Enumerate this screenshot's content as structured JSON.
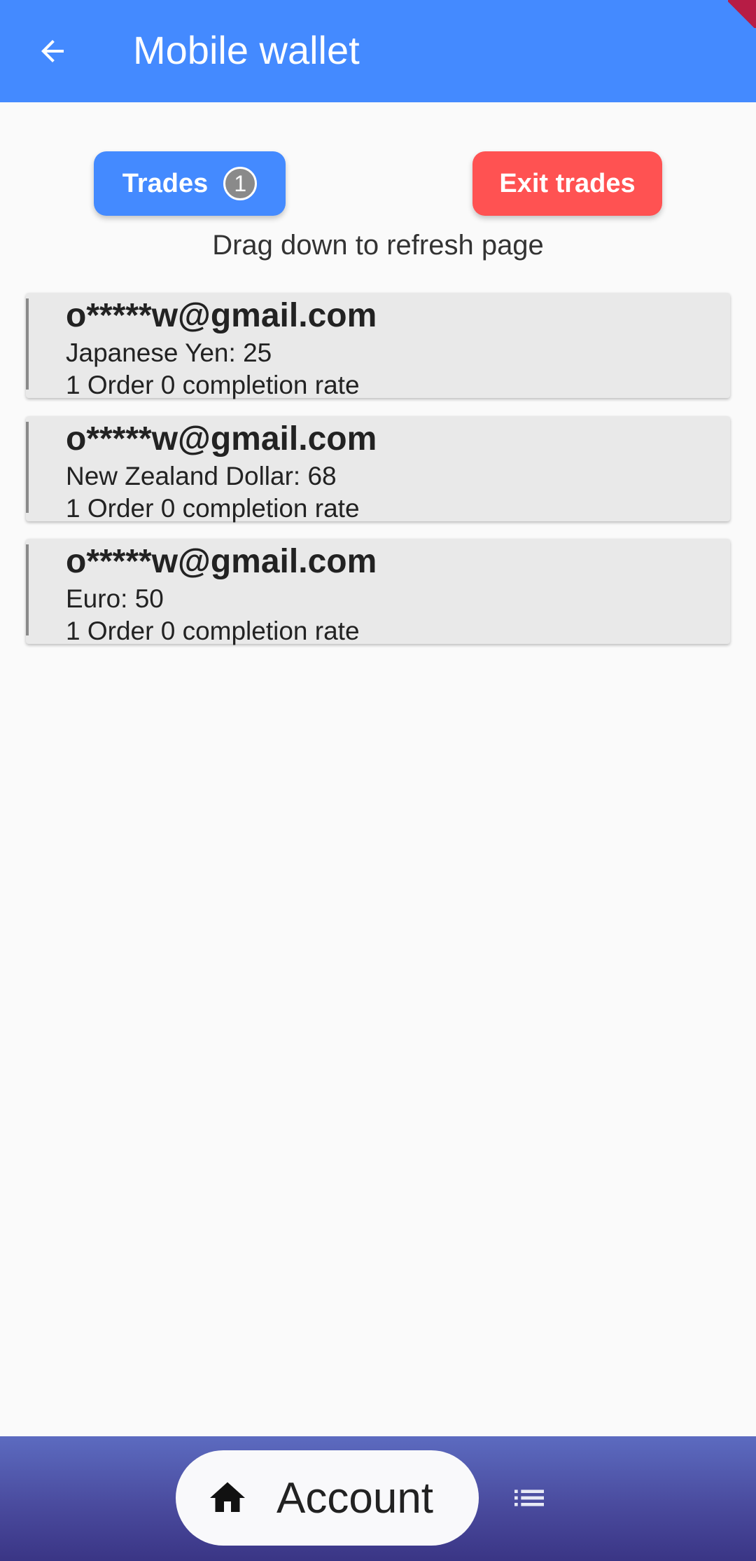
{
  "appbar": {
    "title": "Mobile wallet",
    "back_icon": "arrow-back-icon"
  },
  "actions": {
    "trades_label": "Trades",
    "trades_badge": "1",
    "exit_label": "Exit trades",
    "hint": "Drag down to refresh page"
  },
  "trades": [
    {
      "email": "o*****w@gmail.com",
      "currency": "Japanese Yen: 25",
      "stats": "1 Order 0 completion rate"
    },
    {
      "email": "o*****w@gmail.com",
      "currency": "New Zealand Dollar: 68",
      "stats": "1 Order 0 completion rate"
    },
    {
      "email": "o*****w@gmail.com",
      "currency": "Euro: 50",
      "stats": "1 Order 0 completion rate"
    }
  ],
  "bottom_nav": {
    "account_label": "Account",
    "home_icon": "home-icon",
    "list_icon": "list-icon"
  },
  "colors": {
    "primary": "#448aff",
    "danger": "#ff5252",
    "nav_top": "#5c6bc0",
    "nav_bottom": "#3a3585"
  }
}
